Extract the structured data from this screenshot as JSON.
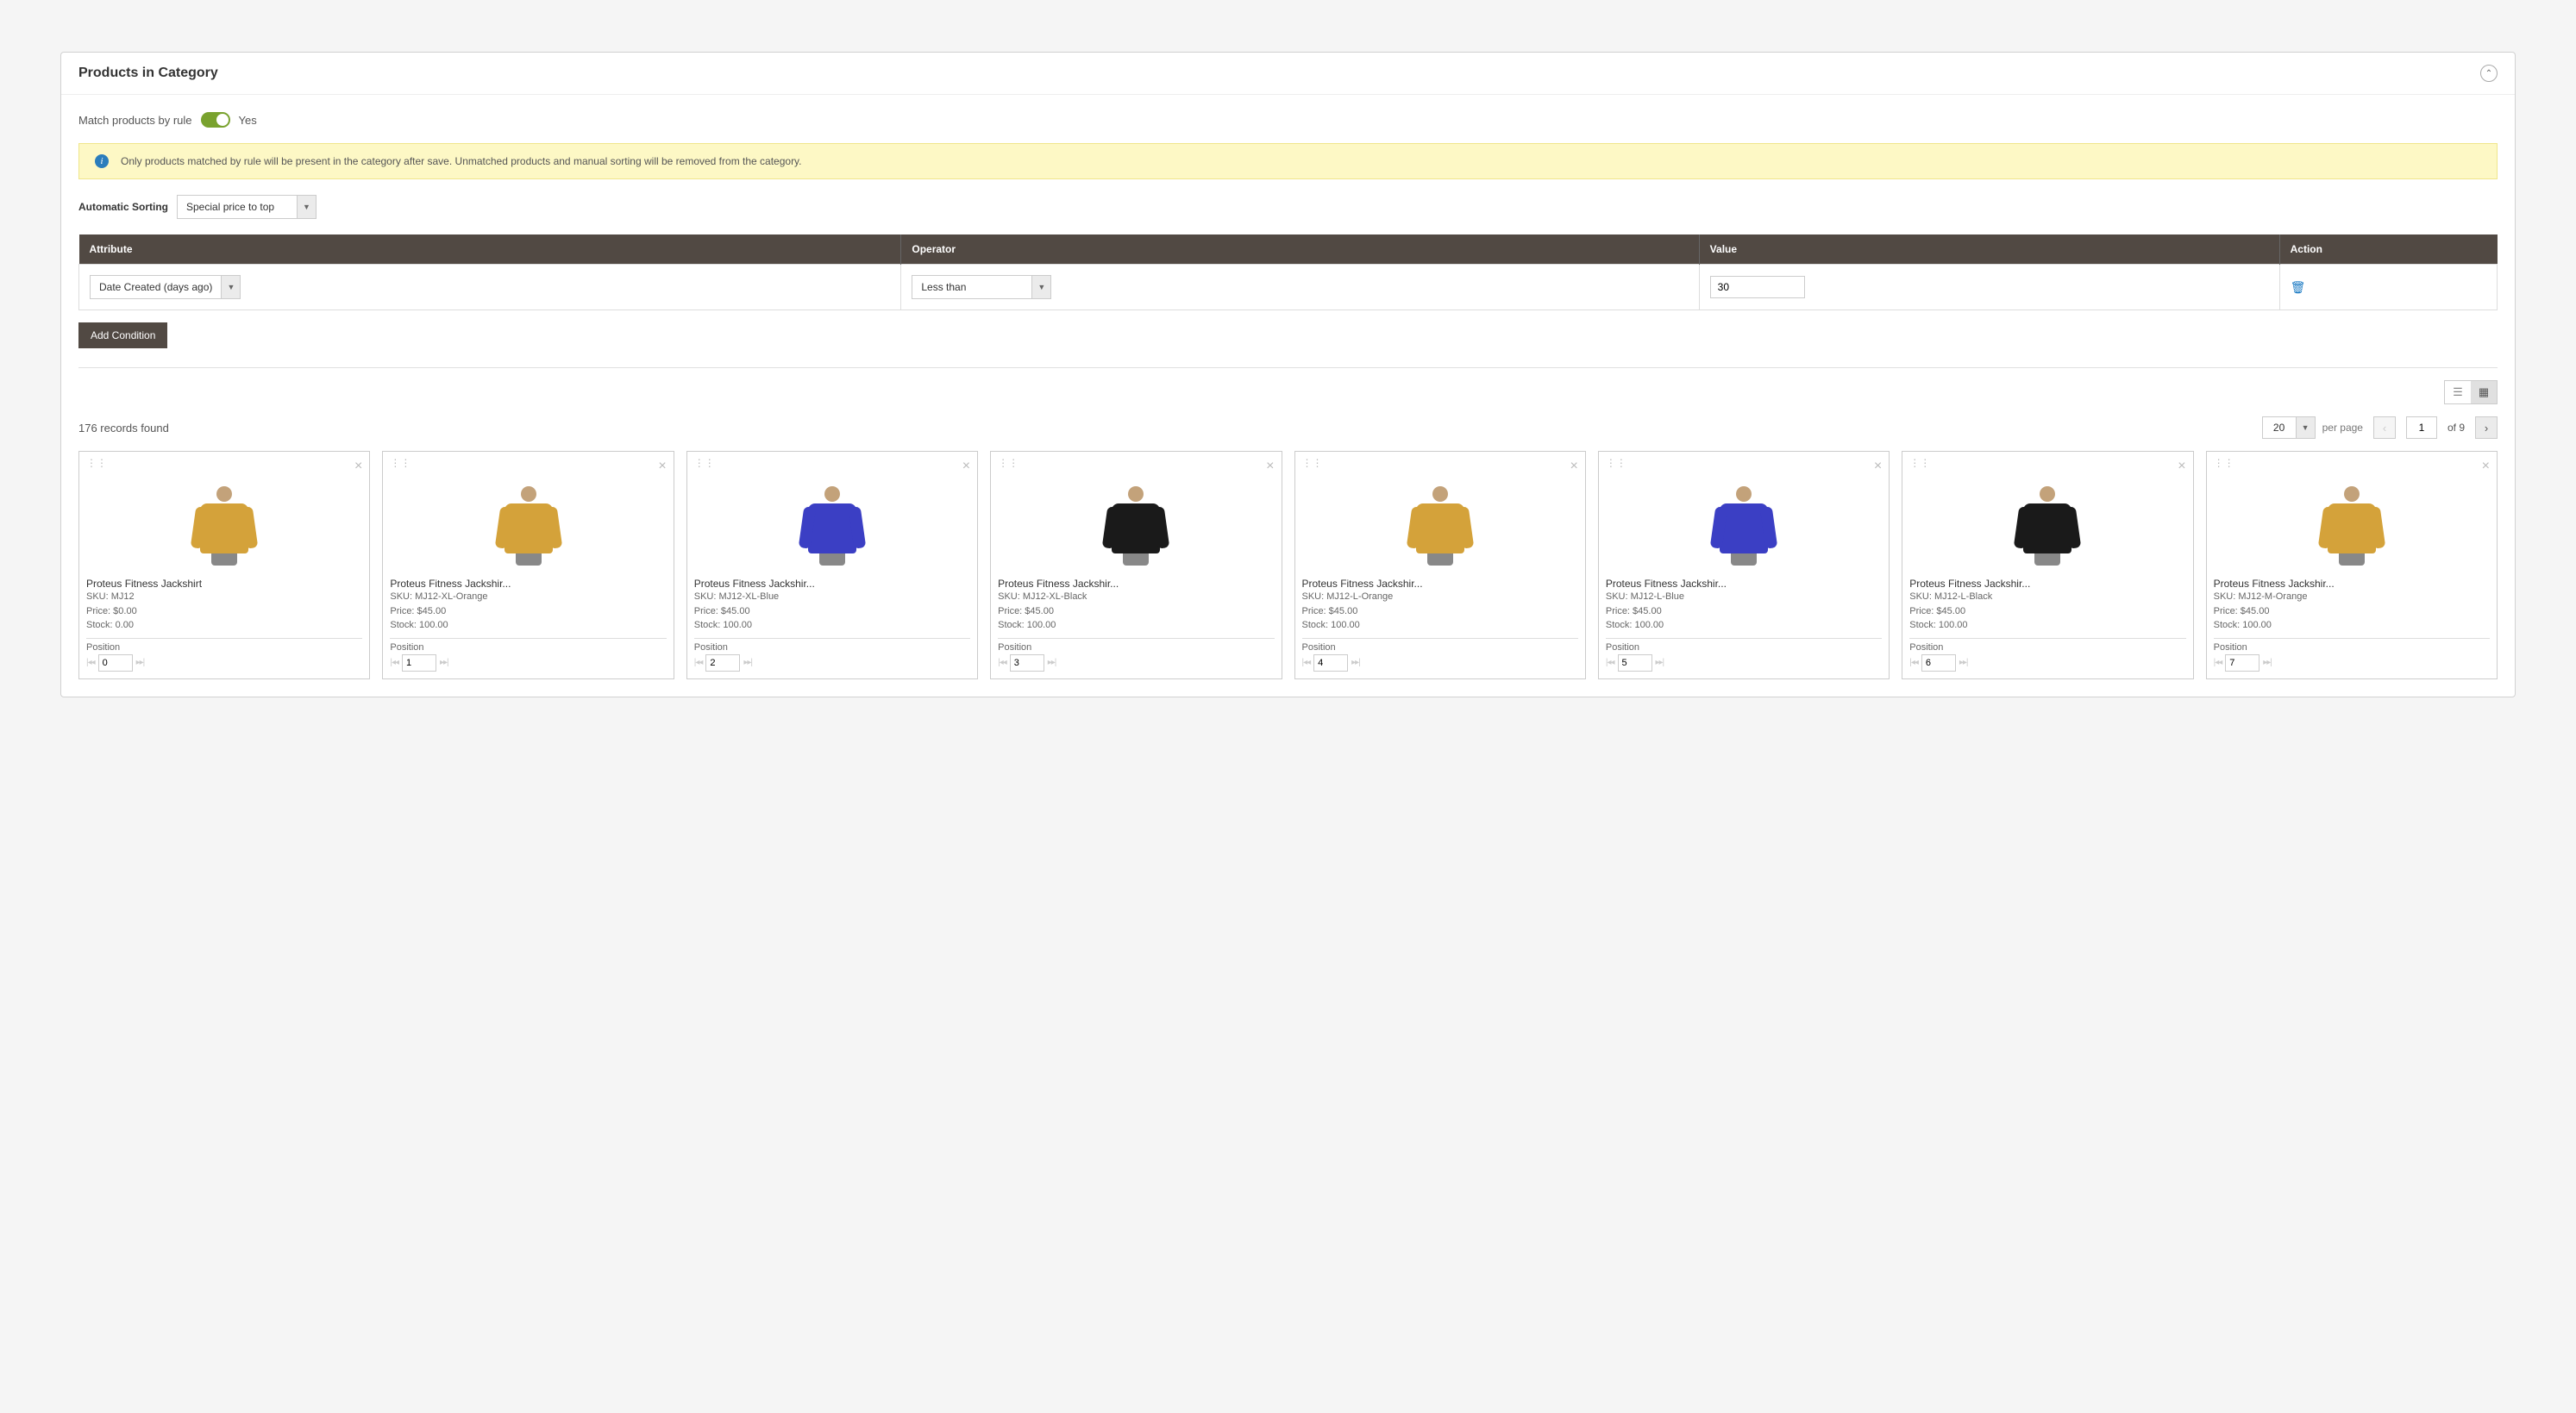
{
  "panel": {
    "title": "Products in Category"
  },
  "match_rule": {
    "label": "Match products by rule",
    "value": "Yes"
  },
  "notice": "Only products matched by rule will be present in the category after save. Unmatched products and manual sorting will be removed from the category.",
  "auto_sort": {
    "label": "Automatic Sorting",
    "selected": "Special price to top"
  },
  "conditions": {
    "headers": {
      "attribute": "Attribute",
      "operator": "Operator",
      "value": "Value",
      "action": "Action"
    },
    "rows": [
      {
        "attribute": "Date Created (days ago)",
        "operator": "Less than",
        "value": "30"
      }
    ],
    "add_label": "Add Condition"
  },
  "pager": {
    "records_found": "176 records found",
    "per_page_value": "20",
    "per_page_label": "per page",
    "current": "1",
    "total": "of 9"
  },
  "position_label": "Position",
  "products": [
    {
      "name": "Proteus Fitness Jackshirt",
      "sku": "SKU: MJ12",
      "price": "Price: $0.00",
      "stock": "Stock: 0.00",
      "position": "0",
      "color": "orange"
    },
    {
      "name": "Proteus Fitness Jackshir...",
      "sku": "SKU: MJ12-XL-Orange",
      "price": "Price: $45.00",
      "stock": "Stock: 100.00",
      "position": "1",
      "color": "orange"
    },
    {
      "name": "Proteus Fitness Jackshir...",
      "sku": "SKU: MJ12-XL-Blue",
      "price": "Price: $45.00",
      "stock": "Stock: 100.00",
      "position": "2",
      "color": "blue"
    },
    {
      "name": "Proteus Fitness Jackshir...",
      "sku": "SKU: MJ12-XL-Black",
      "price": "Price: $45.00",
      "stock": "Stock: 100.00",
      "position": "3",
      "color": "black"
    },
    {
      "name": "Proteus Fitness Jackshir...",
      "sku": "SKU: MJ12-L-Orange",
      "price": "Price: $45.00",
      "stock": "Stock: 100.00",
      "position": "4",
      "color": "orange"
    },
    {
      "name": "Proteus Fitness Jackshir...",
      "sku": "SKU: MJ12-L-Blue",
      "price": "Price: $45.00",
      "stock": "Stock: 100.00",
      "position": "5",
      "color": "blue"
    },
    {
      "name": "Proteus Fitness Jackshir...",
      "sku": "SKU: MJ12-L-Black",
      "price": "Price: $45.00",
      "stock": "Stock: 100.00",
      "position": "6",
      "color": "black"
    },
    {
      "name": "Proteus Fitness Jackshir...",
      "sku": "SKU: MJ12-M-Orange",
      "price": "Price: $45.00",
      "stock": "Stock: 100.00",
      "position": "7",
      "color": "orange"
    }
  ]
}
